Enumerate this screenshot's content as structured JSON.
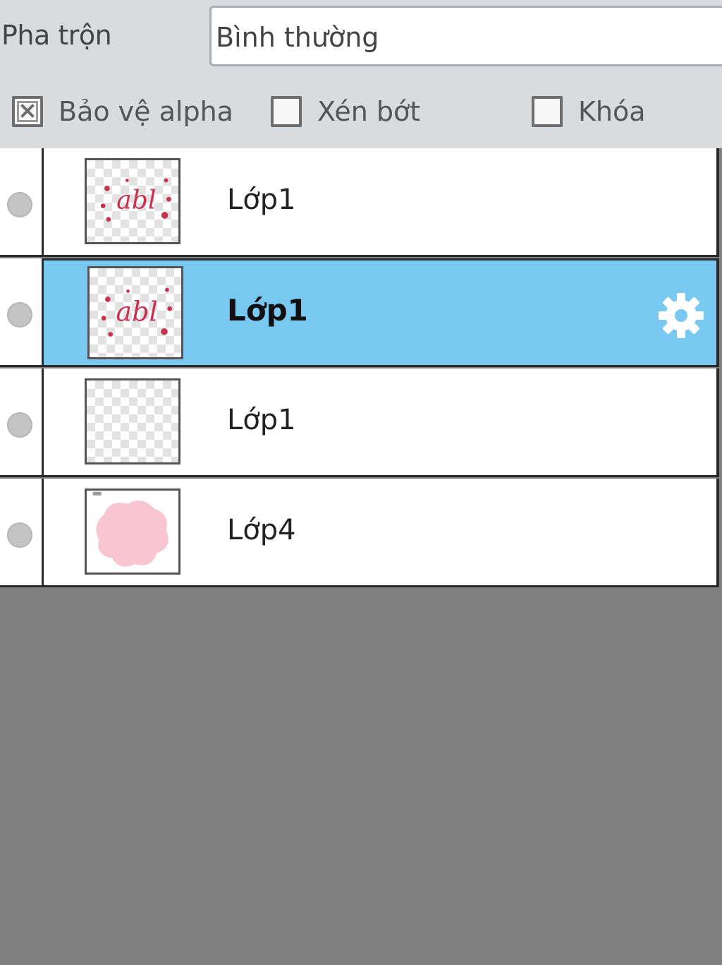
{
  "blend": {
    "label": "Pha trộn",
    "value": "Bình thường"
  },
  "options": [
    {
      "label": "Bảo vệ alpha",
      "checked": true
    },
    {
      "label": "Xén bớt",
      "checked": false
    },
    {
      "label": "Khóa",
      "checked": false
    }
  ],
  "layers": [
    {
      "name": "Lớp1",
      "thumbnail": "abl-text",
      "selected": false
    },
    {
      "name": "Lớp1",
      "thumbnail": "abl-text",
      "selected": true
    },
    {
      "name": "Lớp1",
      "thumbnail": "empty",
      "selected": false
    },
    {
      "name": "Lớp4",
      "thumbnail": "pink-blob",
      "selected": false
    }
  ],
  "colors": {
    "selected_row": "#79c8f1",
    "panel_bg": "#d9dcdf",
    "empty_area": "#808080",
    "thumb_text": "#c8324f",
    "blob": "#f7c6d0"
  },
  "icons": {
    "visibility": "circle-dot-icon",
    "settings": "gear-icon"
  }
}
